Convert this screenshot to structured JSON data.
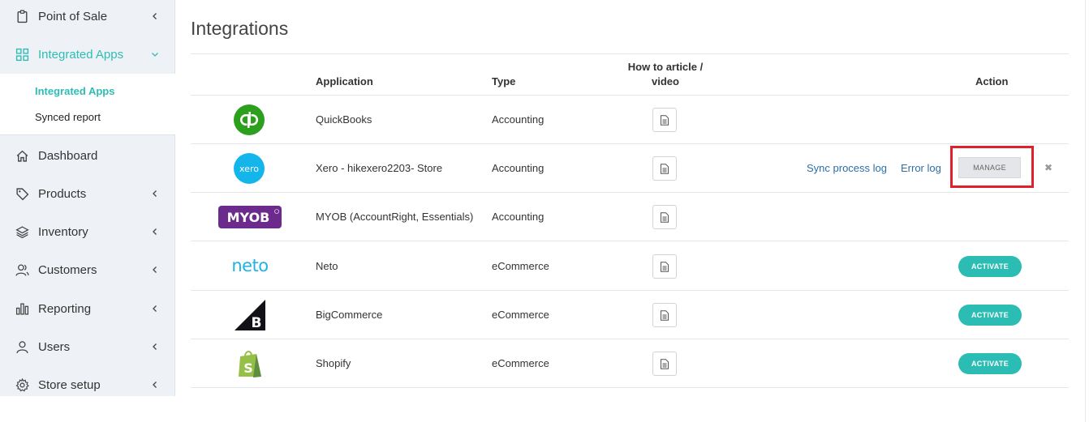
{
  "sidebar": {
    "point_of_sale": "Point of Sale",
    "integrated_apps": "Integrated Apps",
    "sub_integrated_apps": "Integrated Apps",
    "sub_synced_report": "Synced report",
    "dashboard": "Dashboard",
    "products": "Products",
    "inventory": "Inventory",
    "customers": "Customers",
    "reporting": "Reporting",
    "users": "Users",
    "store_setup": "Store setup"
  },
  "page": {
    "title": "Integrations"
  },
  "table": {
    "headers": {
      "application": "Application",
      "type": "Type",
      "howto_line1": "How to article /",
      "howto_line2": "video",
      "action": "Action"
    },
    "rows": [
      {
        "logo": "qb",
        "name": "QuickBooks",
        "type": "Accounting"
      },
      {
        "logo": "xero",
        "name": "Xero - hikexero2203- Store",
        "type": "Accounting",
        "sync_log": "Sync process log",
        "error_log": "Error log",
        "manage": "MANAGE"
      },
      {
        "logo": "MYOB",
        "name": "MYOB (AccountRight, Essentials)",
        "type": "Accounting"
      },
      {
        "logo": "neto",
        "name": "Neto",
        "type": "eCommerce",
        "activate": "ACTIVATE"
      },
      {
        "logo": "B",
        "name": "BigCommerce",
        "type": "eCommerce",
        "activate": "ACTIVATE"
      },
      {
        "logo": "S",
        "name": "Shopify",
        "type": "eCommerce",
        "activate": "ACTIVATE"
      }
    ]
  },
  "colors": {
    "accent": "#2bbcb3",
    "highlight": "#e0202a",
    "link": "#2a6fa8"
  }
}
